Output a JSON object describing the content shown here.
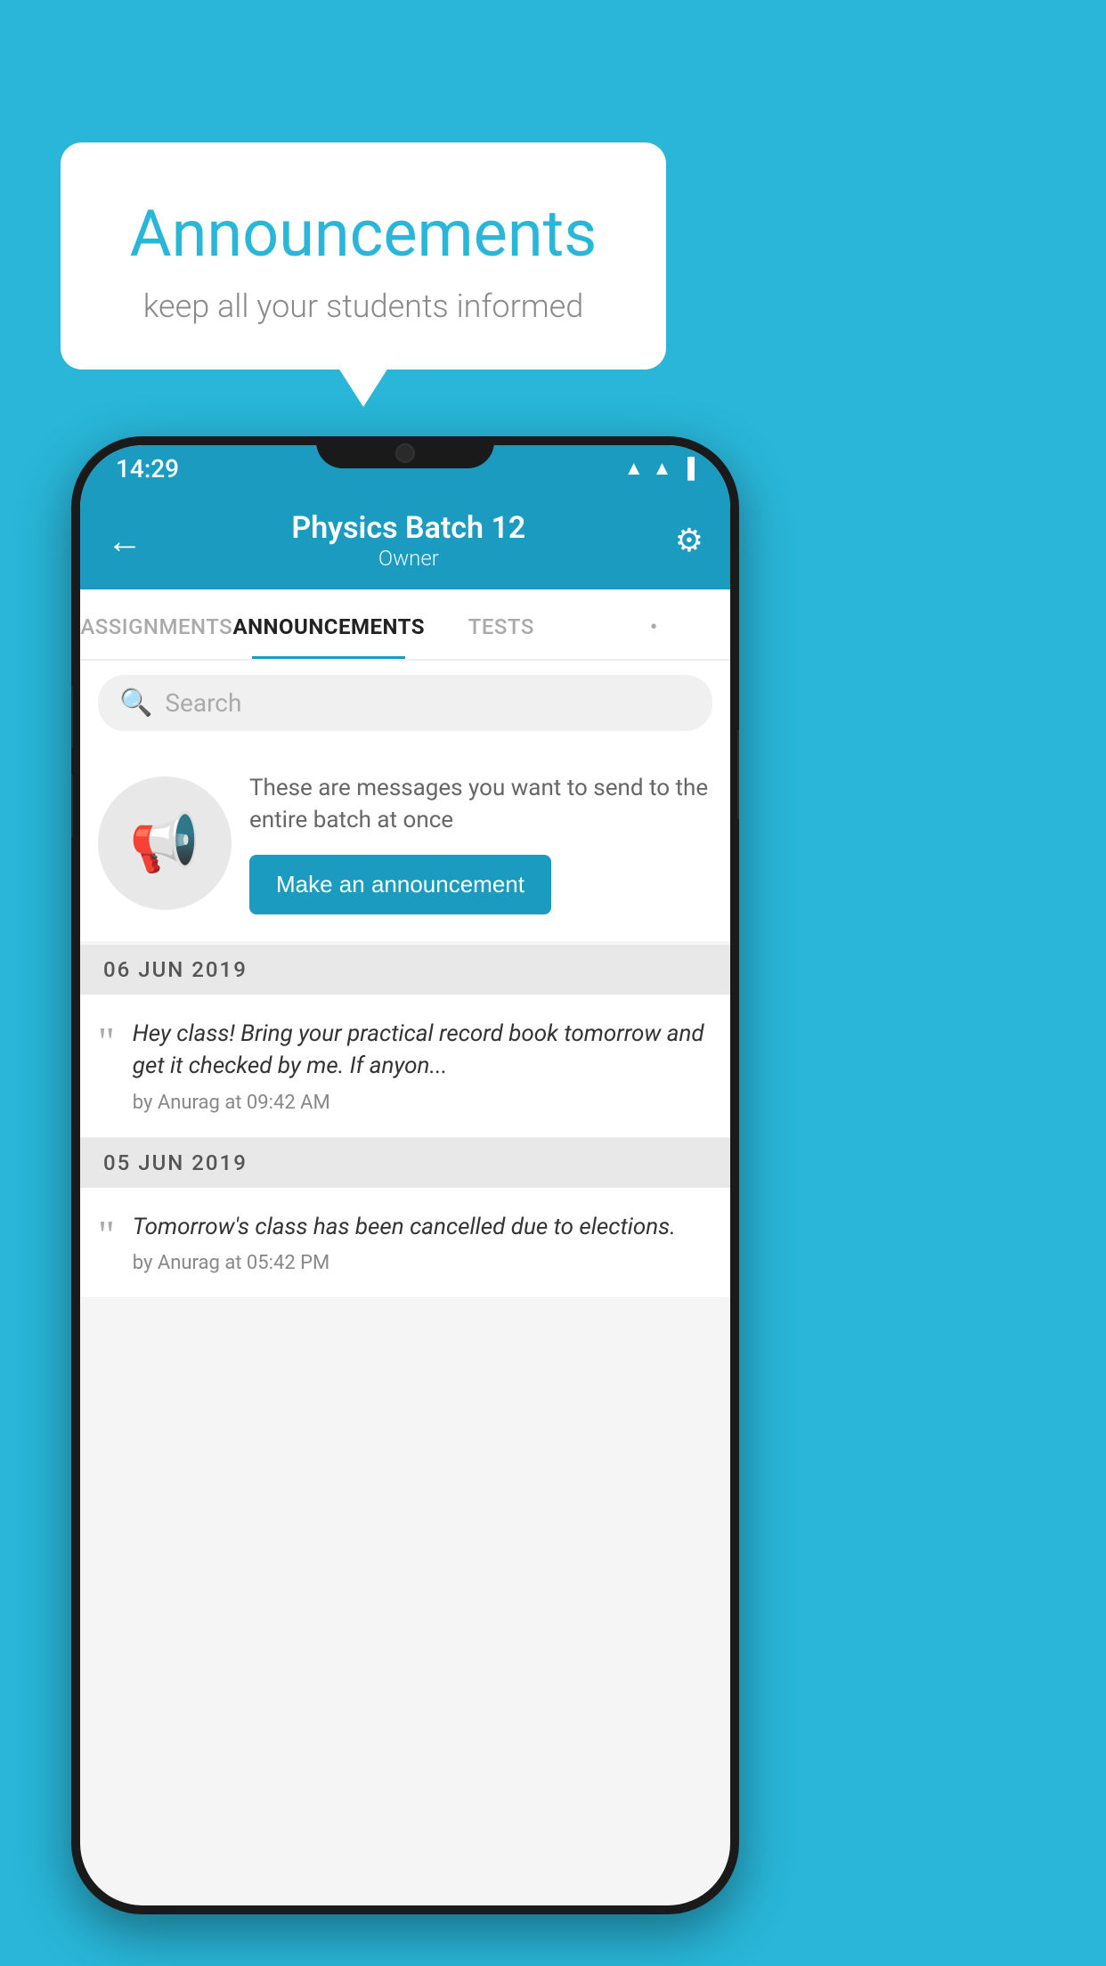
{
  "background_color": "#29b6d8",
  "speech_bubble": {
    "title": "Announcements",
    "subtitle": "keep all your students informed"
  },
  "phone": {
    "status_bar": {
      "time": "14:29",
      "icons": "▼◀▐"
    },
    "header": {
      "title": "Physics Batch 12",
      "subtitle": "Owner",
      "back_label": "←",
      "gear_label": "⚙"
    },
    "tabs": [
      {
        "label": "ASSIGNMENTS",
        "active": false
      },
      {
        "label": "ANNOUNCEMENTS",
        "active": true
      },
      {
        "label": "TESTS",
        "active": false
      },
      {
        "label": "•",
        "active": false
      }
    ],
    "search": {
      "placeholder": "Search"
    },
    "promo": {
      "description": "These are messages you want to send to the entire batch at once",
      "button_label": "Make an announcement"
    },
    "announcements": [
      {
        "date": "06  JUN  2019",
        "text": "Hey class! Bring your practical record book tomorrow and get it checked by me. If anyon...",
        "author": "by Anurag at 09:42 AM"
      },
      {
        "date": "05  JUN  2019",
        "text": "Tomorrow's class has been cancelled due to elections.",
        "author": "by Anurag at 05:42 PM"
      }
    ]
  }
}
